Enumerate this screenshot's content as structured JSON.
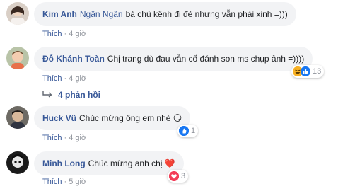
{
  "comments": [
    {
      "author": "Kim Anh",
      "tag": "Ngân Ngân",
      "text": "bà chủ kênh đi đẻ nhưng vẫn phải xinh =)))",
      "like_label": "Thích",
      "time": "4 giờ"
    },
    {
      "author": "Đỗ Khánh Toàn",
      "text": "Chị trang dù đau vẫn cố đánh son ms chụp ảnh =))))",
      "like_label": "Thích",
      "time": "4 giờ",
      "reaction": {
        "icons": [
          "haha-icon",
          "like-icon"
        ],
        "count": "13"
      },
      "replies_label": "4 phản hồi"
    },
    {
      "author": "Huck Vũ",
      "text": "Chúc mừng ông em nhé 😏",
      "like_label": "Thích",
      "time": "4 giờ",
      "reaction": {
        "icons": [
          "like-icon"
        ],
        "count": "1"
      }
    },
    {
      "author": "Minh Long",
      "text": "Chúc mừng anh chị ❤️",
      "like_label": "Thích",
      "time": "5 giờ",
      "reaction": {
        "icons": [
          "love-icon"
        ],
        "count": "3"
      }
    }
  ],
  "colors": {
    "link": "#385898",
    "bubble": "#f2f3f5",
    "meta": "#90949c",
    "like": "#1877f2",
    "love": "#f33e58",
    "haha": "#f7b125"
  }
}
